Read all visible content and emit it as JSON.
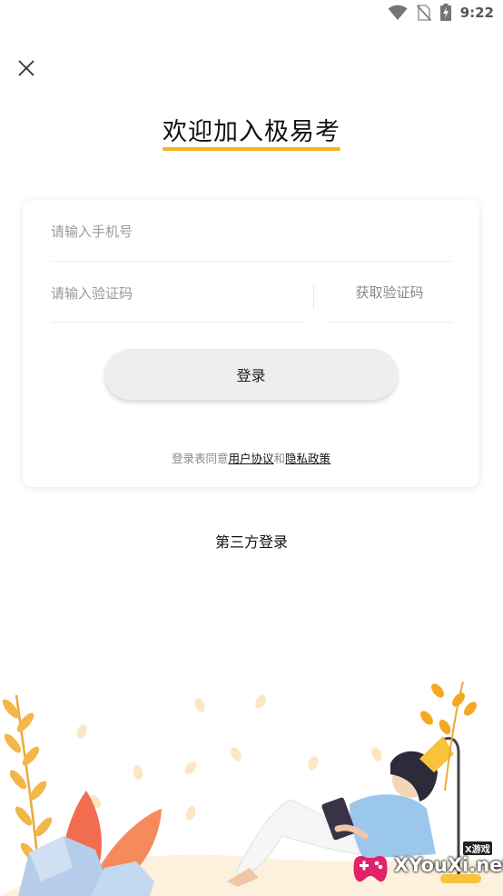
{
  "status_bar": {
    "time": "9:22",
    "icons": [
      "wifi-icon",
      "no-sim-icon",
      "battery-charging-icon"
    ]
  },
  "header": {
    "close_icon": "close-icon",
    "title": "欢迎加入极易考",
    "accent_color": "#f5b21b"
  },
  "form": {
    "phone_placeholder": "请输入手机号",
    "code_placeholder": "请输入验证码",
    "get_code_label": "获取验证码",
    "login_label": "登录"
  },
  "agreement": {
    "prefix": "登录表同意",
    "user_agreement": "用户协议",
    "conjunction": "和",
    "privacy_policy": "隐私政策"
  },
  "third_party_label": "第三方登录",
  "watermark": {
    "brand": "XYouXi.net",
    "badge": "X游戏"
  }
}
